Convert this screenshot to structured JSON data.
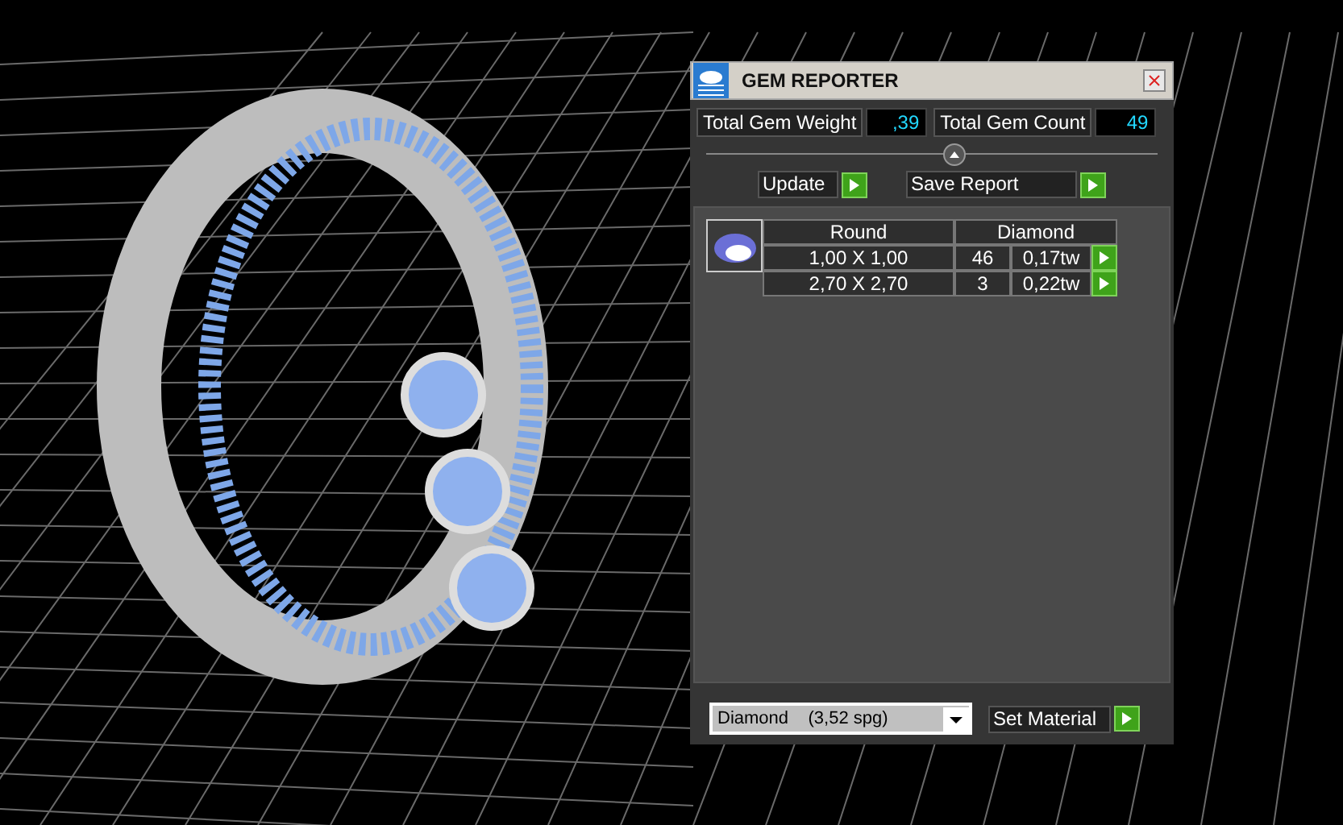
{
  "window": {
    "title": "GEM REPORTER"
  },
  "totals": [
    {
      "label": "Total Gem Weight",
      "value": ",39"
    },
    {
      "label": "Total Gem Count",
      "value": "49"
    }
  ],
  "slider": {
    "level": 0.55
  },
  "actions": [
    {
      "label": "Update"
    },
    {
      "label": "Save Report"
    }
  ],
  "table": {
    "columns": [
      "Round",
      "Diamond"
    ],
    "rows": [
      {
        "size": "1,00 X 1,00",
        "count": "46",
        "weight": "0,17tw"
      },
      {
        "size": "2,70 X 2,70",
        "count": "3",
        "weight": "0,22tw"
      }
    ]
  },
  "material": {
    "value": "Diamond    (3,52 spg)",
    "button": "Set Material"
  }
}
